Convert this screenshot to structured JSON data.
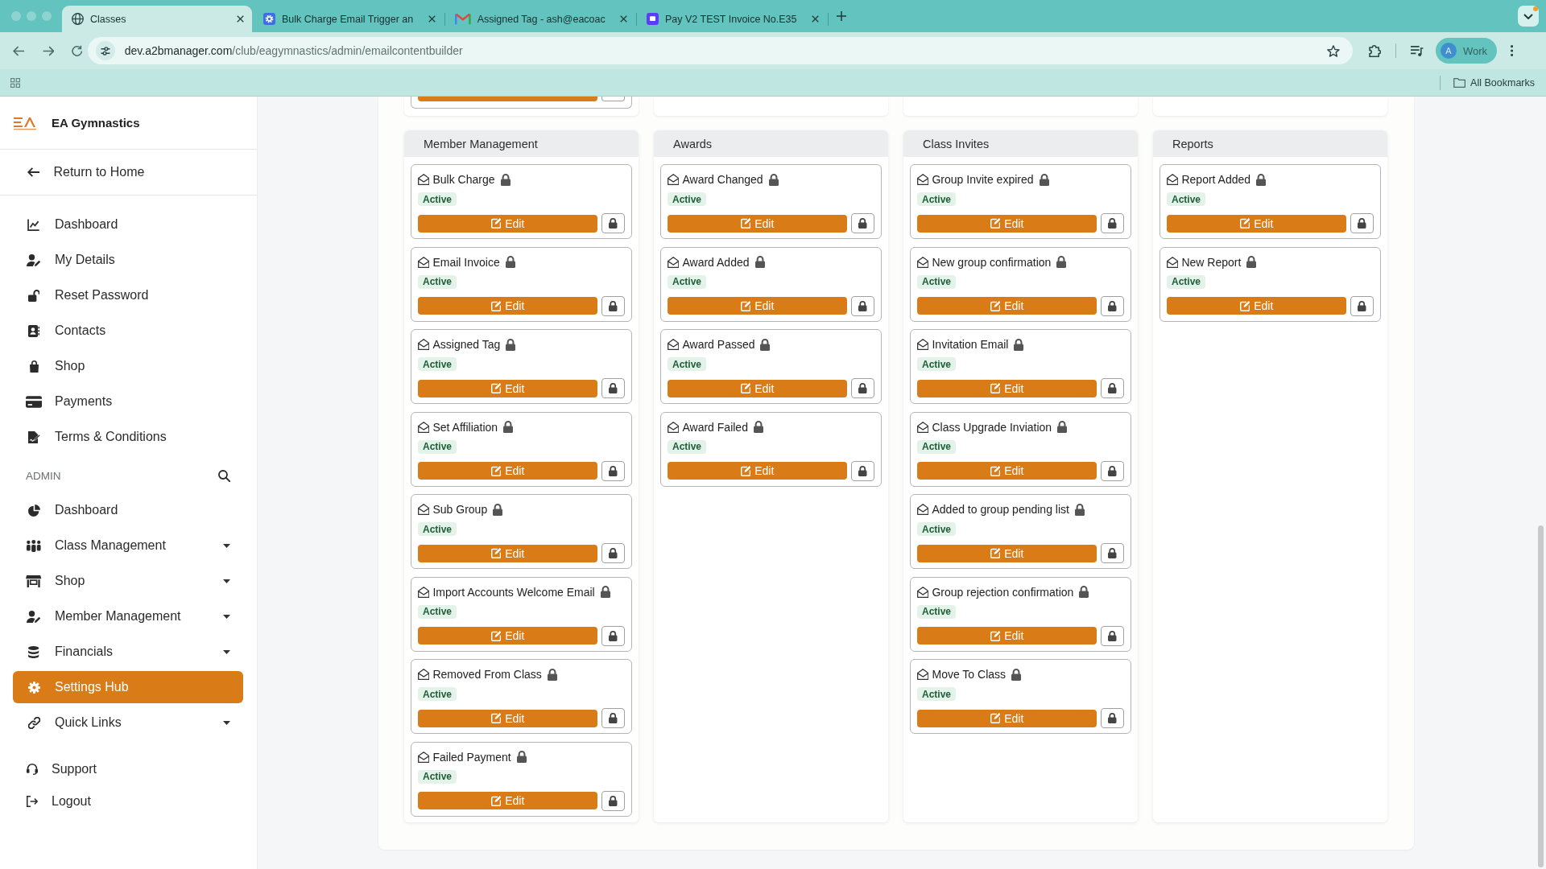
{
  "browser": {
    "tabs": [
      {
        "title": "Classes",
        "selected": true
      },
      {
        "title": "Bulk Charge Email Trigger an",
        "selected": false
      },
      {
        "title": "Assigned Tag - ash@eacoac",
        "selected": false
      },
      {
        "title": "Pay V2 TEST Invoice No.E35",
        "selected": false
      }
    ],
    "address": {
      "host": "dev.a2bmanager.com",
      "path": "/club/eagymnastics/admin/emailcontentbuilder"
    },
    "profile": {
      "initial": "A",
      "label": "Work"
    },
    "bookmarks_bar": {
      "folder": "All Bookmarks"
    }
  },
  "sidebar": {
    "brand": "EA Gymnastics",
    "back_link": "Return to Home",
    "items": [
      {
        "label": "Dashboard",
        "selected": false
      },
      {
        "label": "My Details",
        "selected": false
      },
      {
        "label": "Reset Password",
        "selected": false
      },
      {
        "label": "Contacts",
        "selected": false
      },
      {
        "label": "Shop",
        "selected": false
      },
      {
        "label": "Payments",
        "selected": false
      },
      {
        "label": "Terms & Conditions",
        "selected": false
      }
    ],
    "admin": {
      "heading": "ADMIN",
      "items": [
        {
          "label": "Dashboard",
          "submenu": false,
          "selected": false
        },
        {
          "label": "Class Management",
          "submenu": true,
          "selected": false
        },
        {
          "label": "Shop",
          "submenu": true,
          "selected": false
        },
        {
          "label": "Member Management",
          "submenu": true,
          "selected": false
        },
        {
          "label": "Financials",
          "submenu": true,
          "selected": false
        },
        {
          "label": "Settings Hub",
          "submenu": false,
          "selected": true
        },
        {
          "label": "Quick Links",
          "submenu": true,
          "selected": false
        }
      ]
    },
    "footer_items": [
      {
        "label": "Support"
      },
      {
        "label": "Logout"
      }
    ]
  },
  "content": {
    "groups_above": [
      {
        "kind": "card"
      },
      {
        "kind": "empty"
      },
      {
        "kind": "empty"
      },
      {
        "kind": "empty"
      }
    ],
    "groups": [
      {
        "title": "Member Management",
        "templates": [
          {
            "name": "Bulk Charge",
            "locked": true,
            "status": "Active",
            "action": "Edit"
          },
          {
            "name": "Email Invoice",
            "locked": true,
            "status": "Active",
            "action": "Edit"
          },
          {
            "name": "Assigned Tag",
            "locked": true,
            "status": "Active",
            "action": "Edit"
          },
          {
            "name": "Set Affiliation",
            "locked": true,
            "status": "Active",
            "action": "Edit"
          },
          {
            "name": "Sub Group",
            "locked": true,
            "status": "Active",
            "action": "Edit"
          },
          {
            "name": "Import Accounts Welcome Email",
            "locked": true,
            "status": "Active",
            "action": "Edit"
          },
          {
            "name": "Removed From Class",
            "locked": true,
            "status": "Active",
            "action": "Edit"
          },
          {
            "name": "Failed Payment",
            "locked": true,
            "status": "Active",
            "action": "Edit"
          }
        ]
      },
      {
        "title": "Awards",
        "templates": [
          {
            "name": "Award Changed",
            "locked": true,
            "status": "Active",
            "action": "Edit"
          },
          {
            "name": "Award Added",
            "locked": true,
            "status": "Active",
            "action": "Edit"
          },
          {
            "name": "Award Passed",
            "locked": true,
            "status": "Active",
            "action": "Edit"
          },
          {
            "name": "Award Failed",
            "locked": true,
            "status": "Active",
            "action": "Edit"
          }
        ]
      },
      {
        "title": "Class Invites",
        "templates": [
          {
            "name": "Group Invite expired",
            "locked": true,
            "status": "Active",
            "action": "Edit"
          },
          {
            "name": "New group confirmation",
            "locked": true,
            "status": "Active",
            "action": "Edit"
          },
          {
            "name": "Invitation Email",
            "locked": true,
            "status": "Active",
            "action": "Edit"
          },
          {
            "name": "Class Upgrade Inviation",
            "locked": true,
            "status": "Active",
            "action": "Edit"
          },
          {
            "name": "Added to group pending list",
            "locked": true,
            "status": "Active",
            "action": "Edit"
          },
          {
            "name": "Group rejection confirmation",
            "locked": true,
            "status": "Active",
            "action": "Edit"
          },
          {
            "name": "Move To Class",
            "locked": true,
            "status": "Active",
            "action": "Edit"
          }
        ]
      },
      {
        "title": "Reports",
        "templates": [
          {
            "name": "Report Added",
            "locked": true,
            "status": "Active",
            "action": "Edit"
          },
          {
            "name": "New Report",
            "locked": true,
            "status": "Active",
            "action": "Edit"
          }
        ]
      }
    ]
  }
}
